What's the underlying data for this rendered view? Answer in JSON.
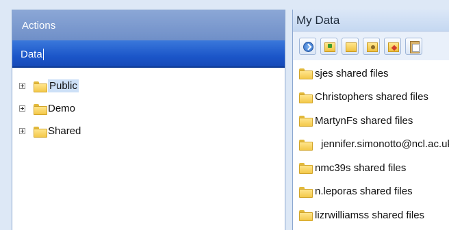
{
  "left_panel": {
    "header": "Actions",
    "tab": "Data",
    "tree": [
      {
        "label": "Public",
        "selected": true
      },
      {
        "label": "Demo",
        "selected": false
      },
      {
        "label": "Shared",
        "selected": false
      }
    ]
  },
  "right_panel": {
    "header": "My Data",
    "toolbar_icons": [
      "refresh-icon",
      "upload-folder-icon",
      "new-folder-icon",
      "share-folder-icon",
      "delete-folder-icon",
      "paste-icon"
    ],
    "items": [
      "sjes shared files",
      "Christophers shared files",
      "MartynFs shared files",
      "jennifer.simonotto@ncl.ac.uk",
      "nmc39s shared files",
      "n.leporas shared files",
      "lizrwilliamss shared files"
    ]
  },
  "colors": {
    "tab_blue": "#1b55c8",
    "header_blue": "#7f9dd0",
    "folder_yellow": "#f3c84a"
  }
}
